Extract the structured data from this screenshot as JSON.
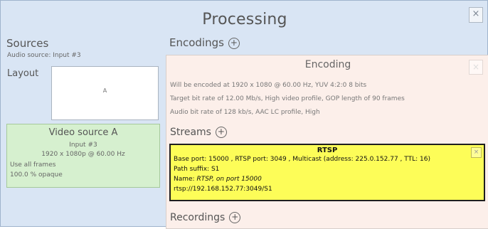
{
  "window": {
    "title": "Processing",
    "close_label": "×"
  },
  "sources": {
    "title": "Sources",
    "audio_source": "Audio source: Input #3",
    "layout_label": "Layout",
    "layout_cell": "A",
    "video_source": {
      "title": "Video source A",
      "input": "Input #3",
      "resolution": "1920 x 1080p @ 60.00 Hz",
      "frames": "Use all frames",
      "opacity": "100.0 % opaque"
    }
  },
  "encodings": {
    "title": "Encodings",
    "add_label": "+",
    "panel": {
      "title": "Encoding",
      "close_label": "×",
      "lines": [
        "Will be encoded at  1920  x  1080  @ 60.00 Hz,  YUV 4:2:0 8 bits",
        "Target bit rate of  12.00  Mb/s,  High video profile, GOP length of 90  frames",
        "Audio bit rate of 128 kb/s,  AAC LC profile, High"
      ]
    },
    "streams": {
      "title": "Streams",
      "add_label": "+",
      "rtsp": {
        "title": "RTSP",
        "close_label": "×",
        "ports_line": "Base port: 15000 , RTSP port: 3049 , Multicast (address: 225.0.152.77 , TTL: 16)",
        "path_line": "Path suffix:  S1",
        "name_label": "Name:  ",
        "name_value": "RTSP, on port 15000",
        "url": "rtsp://192.168.152.77:3049/S1"
      }
    },
    "recordings": {
      "title": "Recordings",
      "add_label": "+"
    }
  }
}
